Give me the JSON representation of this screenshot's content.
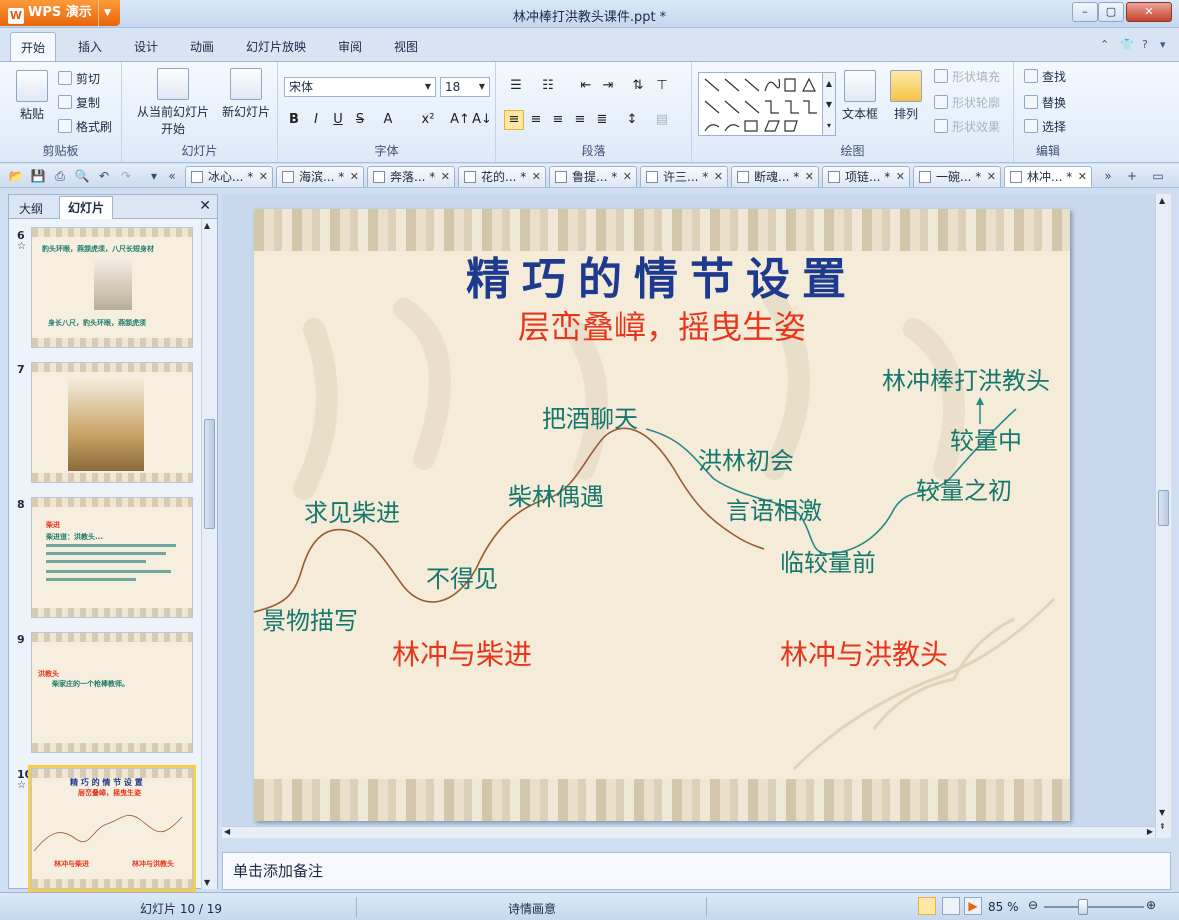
{
  "app": {
    "name": "WPS 演示",
    "doc_title": "林冲棒打洪教头课件.ppt *"
  },
  "ribbon_tabs": [
    "开始",
    "插入",
    "设计",
    "动画",
    "幻灯片放映",
    "审阅",
    "视图"
  ],
  "ribbon": {
    "clipboard": {
      "paste": "粘贴",
      "cut": "剪切",
      "copy": "复制",
      "format_painter": "格式刷",
      "label": "剪贴板"
    },
    "slides": {
      "from_current": "从当前幻灯片",
      "from_current_2": "开始",
      "new_slide": "新幻灯片",
      "label": "幻灯片"
    },
    "font": {
      "family": "宋体",
      "size": "18",
      "label": "字体",
      "bold": "B",
      "italic": "I",
      "underline": "U",
      "strike": "S"
    },
    "paragraph": {
      "label": "段落"
    },
    "drawing": {
      "textbox": "文本框",
      "arrange": "排列",
      "fill": "形状填充",
      "outline": "形状轮廓",
      "effect": "形状效果",
      "label": "绘图"
    },
    "editing": {
      "find": "查找",
      "replace": "替换",
      "select": "选择",
      "label": "编辑"
    }
  },
  "doc_tabs": [
    "冰心... *",
    "海滨... *",
    "奔落... *",
    "花的... *",
    "鲁提... *",
    "许三... *",
    "断魂... *",
    "项链... *",
    "一碗... *",
    "林冲... *"
  ],
  "left_pane": {
    "tabs": [
      "大纲",
      "幻灯片"
    ],
    "thumbs": [
      {
        "num": "6",
        "star": "☆",
        "lines": [
          "豹头环眼，燕颔虎须，八尺长短身材",
          "身长八尺，豹头环眼，燕颔虎须"
        ]
      },
      {
        "num": "7",
        "star": "",
        "lines": []
      },
      {
        "num": "8",
        "star": "",
        "lines": [
          "柴进",
          "柴进道：洪教头..."
        ]
      },
      {
        "num": "9",
        "star": "",
        "lines": [
          "洪教头",
          "柴家庄的一个枪棒教师。"
        ]
      },
      {
        "num": "10",
        "star": "☆",
        "lines": [
          "精 巧 的 情 节 设 置",
          "层峦叠嶂，摇曳生姿",
          "林冲与柴进",
          "林冲与洪教头"
        ]
      }
    ]
  },
  "slide": {
    "title": "精巧的情节设置",
    "subtitle": "层峦叠嶂，摇曳生姿",
    "labels": {
      "l1": "景物描写",
      "l2": "求见柴进",
      "l3": "不得见",
      "l4": "柴林偶遇",
      "l5": "把酒聊天",
      "l6": "洪林初会",
      "l7": "言语相激",
      "l8": "临较量前",
      "l9": "较量之初",
      "l10": "较量中",
      "l11": "林冲棒打洪教头",
      "left_section": "林冲与柴进",
      "right_section": "林冲与洪教头"
    }
  },
  "notes_placeholder": "单击添加备注",
  "status": {
    "slide_count": "幻灯片 10 / 19",
    "theme": "诗情画意",
    "zoom": "85 %"
  },
  "colors": {
    "title_blue": "#1d3a8f",
    "subtitle_red": "#e8361d",
    "teal": "#16776c",
    "curve_brown": "#9b5a33",
    "curve_teal": "#2a8a86"
  }
}
